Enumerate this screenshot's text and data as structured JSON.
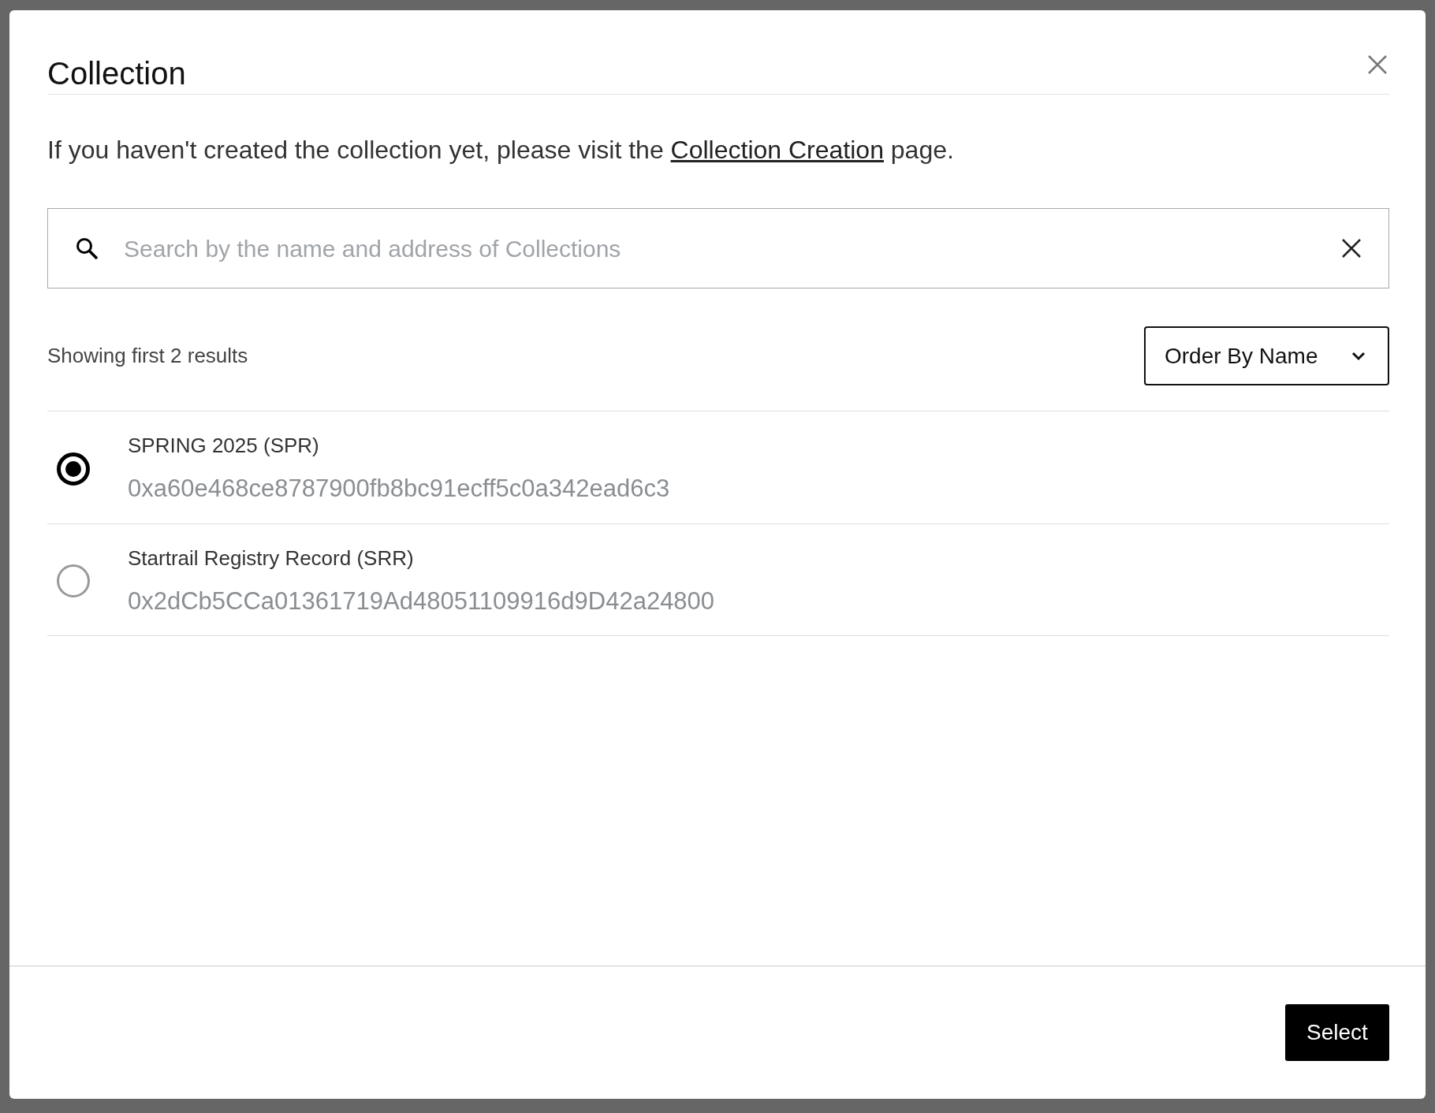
{
  "dialog": {
    "title": "Collection",
    "intro": {
      "before": "If you haven't created the collection yet, please visit the ",
      "link": "Collection Creation",
      "after": " page."
    },
    "search": {
      "placeholder": "Search by the name and address of Collections"
    },
    "result_count": "Showing first 2 results",
    "sort": {
      "label": "Order By Name"
    },
    "collections": [
      {
        "name": "SPRING 2025 (SPR)",
        "address": "0xa60e468ce8787900fb8bc91ecff5c0a342ead6c3",
        "selected": true
      },
      {
        "name": "Startrail Registry Record (SRR)",
        "address": "0x2dCb5CCa01361719Ad48051109916d9D42a24800",
        "selected": false
      }
    ],
    "buttons": [
      "Select"
    ]
  }
}
